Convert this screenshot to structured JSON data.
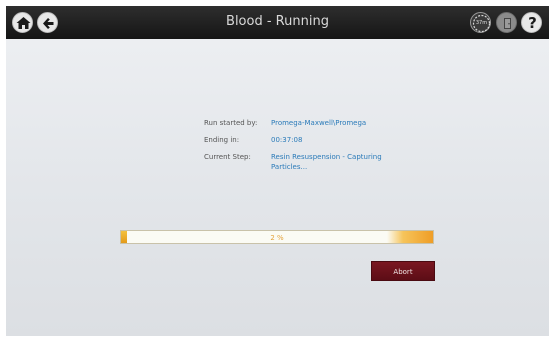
{
  "header": {
    "title": "Blood - Running",
    "clock_badge": "37m"
  },
  "run_info": {
    "started_by_label": "Run started by:",
    "started_by_value": "Promega-Maxwell\\Promega",
    "ending_in_label": "Ending in:",
    "ending_in_value": "00:37:08",
    "current_step_label": "Current Step:",
    "current_step_value_line1": "Resin Resuspension - Capturing",
    "current_step_value_line2": "Particles..."
  },
  "progress": {
    "percent": 2,
    "text": "2 %"
  },
  "actions": {
    "abort_label": "Abort"
  },
  "colors": {
    "title_bar": "#1f1f1f",
    "value_text": "#2b7bb9",
    "progress_fill": "#e8a21f",
    "abort_button": "#6b121b"
  },
  "icons": [
    "home-icon",
    "back-arrow-icon",
    "timer-icon",
    "door-icon",
    "help-icon"
  ]
}
